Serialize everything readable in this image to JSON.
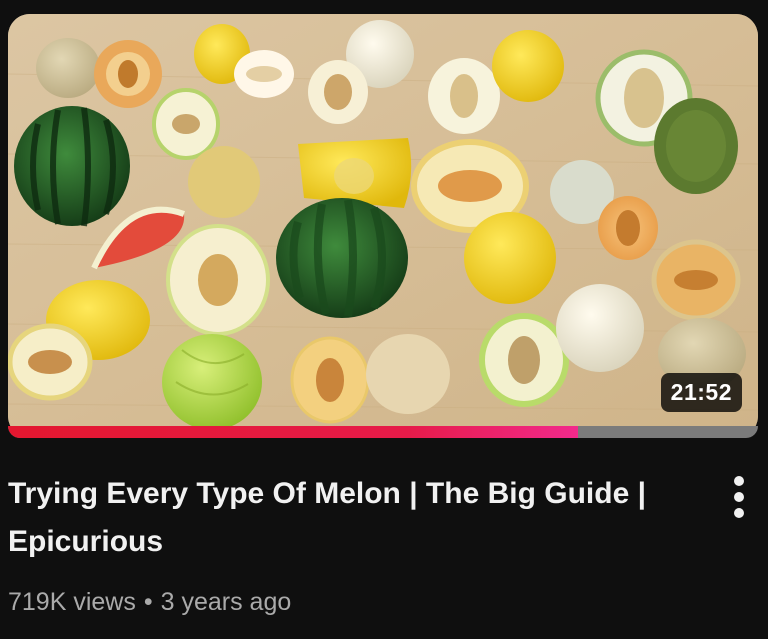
{
  "video": {
    "title": "Trying Every Type Of Melon | The Big Guide | Epicurious",
    "duration": "21:52",
    "views": "719K views",
    "separator": "•",
    "age": "3 years ago",
    "watch_progress": 0.76
  },
  "colors": {
    "background": "#0f0f0f",
    "title_text": "#f1f1f1",
    "meta_text": "#aaaaaa",
    "progress_red": "#e3172f",
    "progress_pink": "#f22a8c",
    "progress_track": "#7b7b7b"
  },
  "icons": {
    "more": "more-vertical-icon"
  }
}
